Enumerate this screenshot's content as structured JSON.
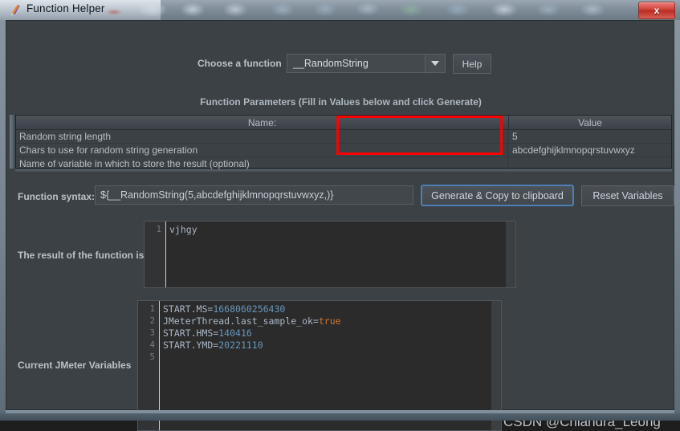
{
  "window": {
    "title": "Function Helper",
    "icon": "jmeter-feather-icon",
    "close_label": "x"
  },
  "toolbar": {
    "choose_label": "Choose a function",
    "function_value": "__RandomString",
    "dropdown_icon": "chevron-down-icon",
    "help_label": "Help"
  },
  "params": {
    "section_title": "Function Parameters (Fill in Values below and click Generate)",
    "columns": [
      "Name:",
      "Value"
    ],
    "rows": [
      {
        "name": "Random string length",
        "value": "5"
      },
      {
        "name": "Chars to use for random string generation",
        "value": "abcdefghijklmnopqrstuvwxyz"
      },
      {
        "name": "Name of variable in which to store the result (optional)",
        "value": ""
      }
    ],
    "highlight_color": "#fe0000"
  },
  "syntax": {
    "label": "Function syntax:",
    "value": "${__RandomString(5,abcdefghijklmnopqrstuvwxyz,)}",
    "generate_label": "Generate & Copy to clipboard",
    "reset_label": "Reset Variables",
    "focus_color": "#4b7fb5"
  },
  "result": {
    "label": "The result of the function is",
    "line_numbers": [
      "1"
    ],
    "lines": [
      "vjhgy"
    ]
  },
  "variables": {
    "label": "Current JMeter Variables",
    "line_numbers": [
      "1",
      "2",
      "3",
      "4",
      "5"
    ],
    "rows": [
      {
        "key": "START.MS=",
        "value": "1668060256430",
        "kind": "number"
      },
      {
        "key": "JMeterThread.last_sample_ok=",
        "value": "true",
        "kind": "boolean"
      },
      {
        "key": "START.HMS=",
        "value": "140416",
        "kind": "number"
      },
      {
        "key": "START.YMD=",
        "value": "20221110",
        "kind": "number"
      },
      {
        "key": "",
        "value": "",
        "kind": "empty"
      }
    ],
    "colors": {
      "key": "#a9b7c6",
      "number": "#6897bb",
      "boolean": "#cc7832"
    }
  },
  "watermark": {
    "text": "CSDN @Chiandra_Leong"
  }
}
